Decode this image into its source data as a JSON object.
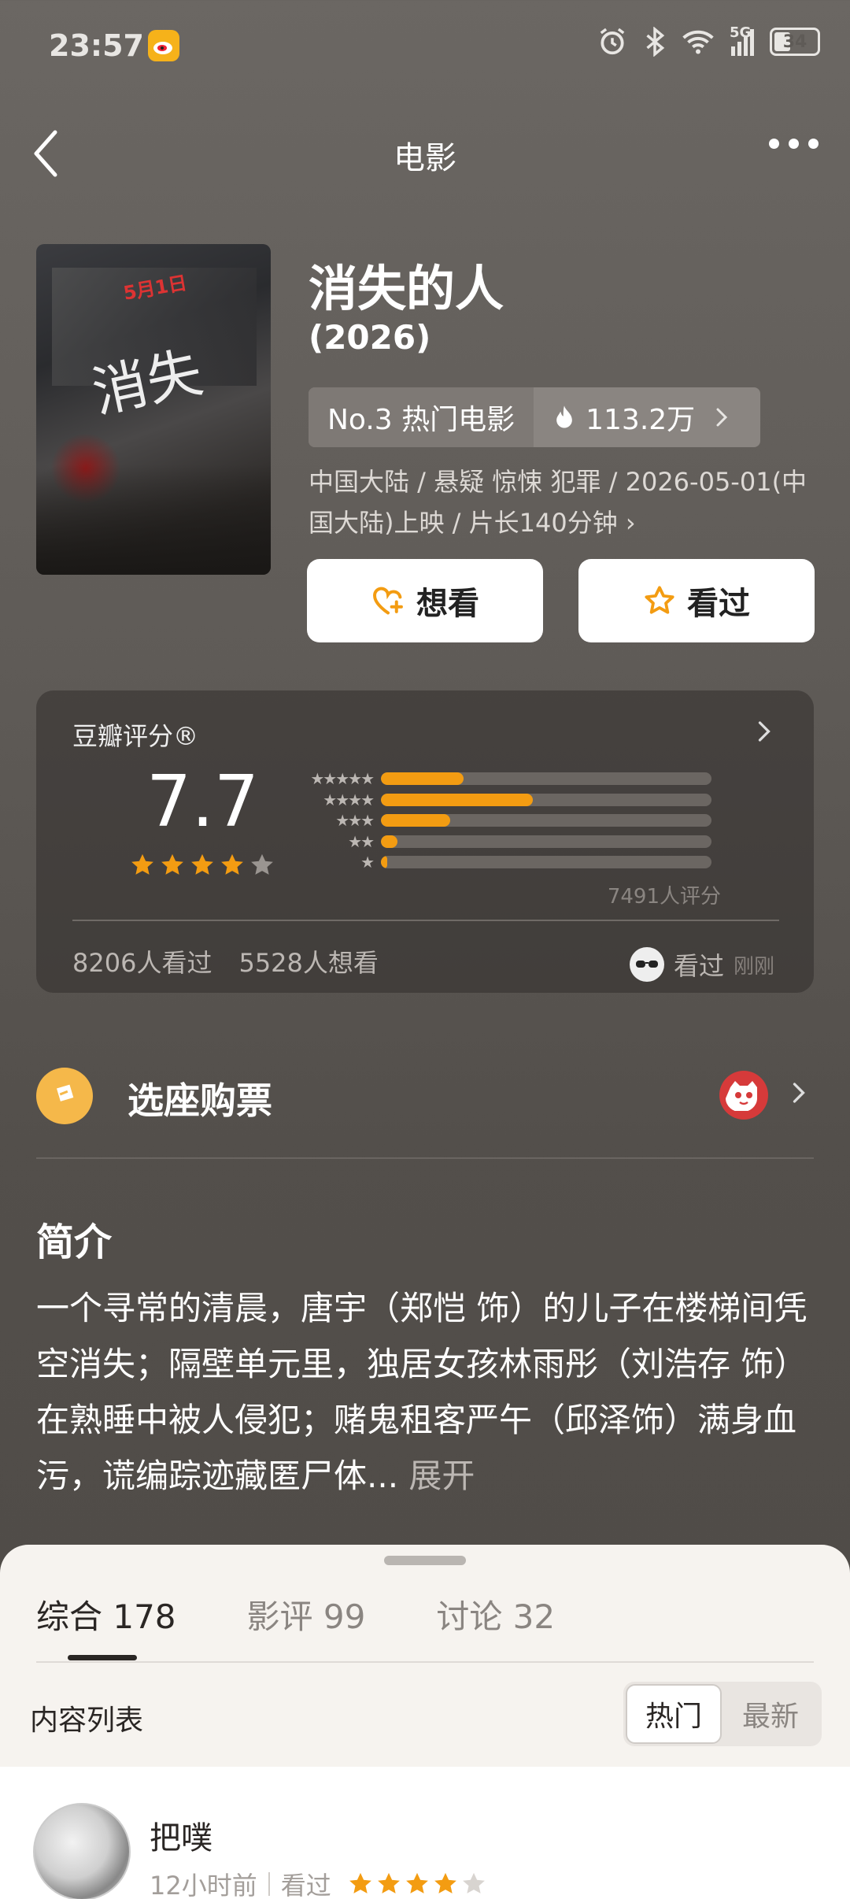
{
  "status_bar": {
    "time": "23:57",
    "signal_label": "5G",
    "battery": "34"
  },
  "nav": {
    "title": "电影"
  },
  "movie": {
    "title": "消失的人",
    "year": "(2026)",
    "rank": "No.3 热门电影",
    "heat": "113.2万",
    "meta": "中国大陆 / 悬疑 惊悚 犯罪 / 2026-05-01(中国大陆)上映 / 片长140分钟 ›",
    "want_label": "想看",
    "seen_label": "看过"
  },
  "rating": {
    "label": "豆瓣评分®",
    "score": "7.7",
    "stars": 4,
    "distribution": [
      {
        "stars": 5,
        "fill": 0.25
      },
      {
        "stars": 4,
        "fill": 0.46
      },
      {
        "stars": 3,
        "fill": 0.21
      },
      {
        "stars": 2,
        "fill": 0.05
      },
      {
        "stars": 1,
        "fill": 0.02
      }
    ],
    "raters": "7491人评分",
    "watched": "8206人看过",
    "wish": "5528人想看",
    "my_status": "看过",
    "my_time": "刚刚"
  },
  "ticket": {
    "label": "选座购票"
  },
  "intro": {
    "heading": "简介",
    "text": "一个寻常的清晨，唐宇（郑恺 饰）的儿子在楼梯间凭空消失；隔壁单元里，独居女孩林雨彤（刘浩存 饰）在熟睡中被人侵犯；赌鬼租客严午（邱泽饰）满身血污，谎编踪迹藏匿尸体...",
    "expand": " 展开"
  },
  "sheet": {
    "tabs": [
      {
        "label": "综合 178"
      },
      {
        "label": "影评 99"
      },
      {
        "label": "讨论 32"
      }
    ],
    "list_title": "内容列表",
    "sort_hot": "热门",
    "sort_new": "最新"
  },
  "post": {
    "user": "把噗",
    "time": "12小时前",
    "status": "看过",
    "stars": 4
  },
  "colors": {
    "accent": "#f39c12",
    "background": "#5f5b57",
    "sheet": "#f6f3ef"
  }
}
